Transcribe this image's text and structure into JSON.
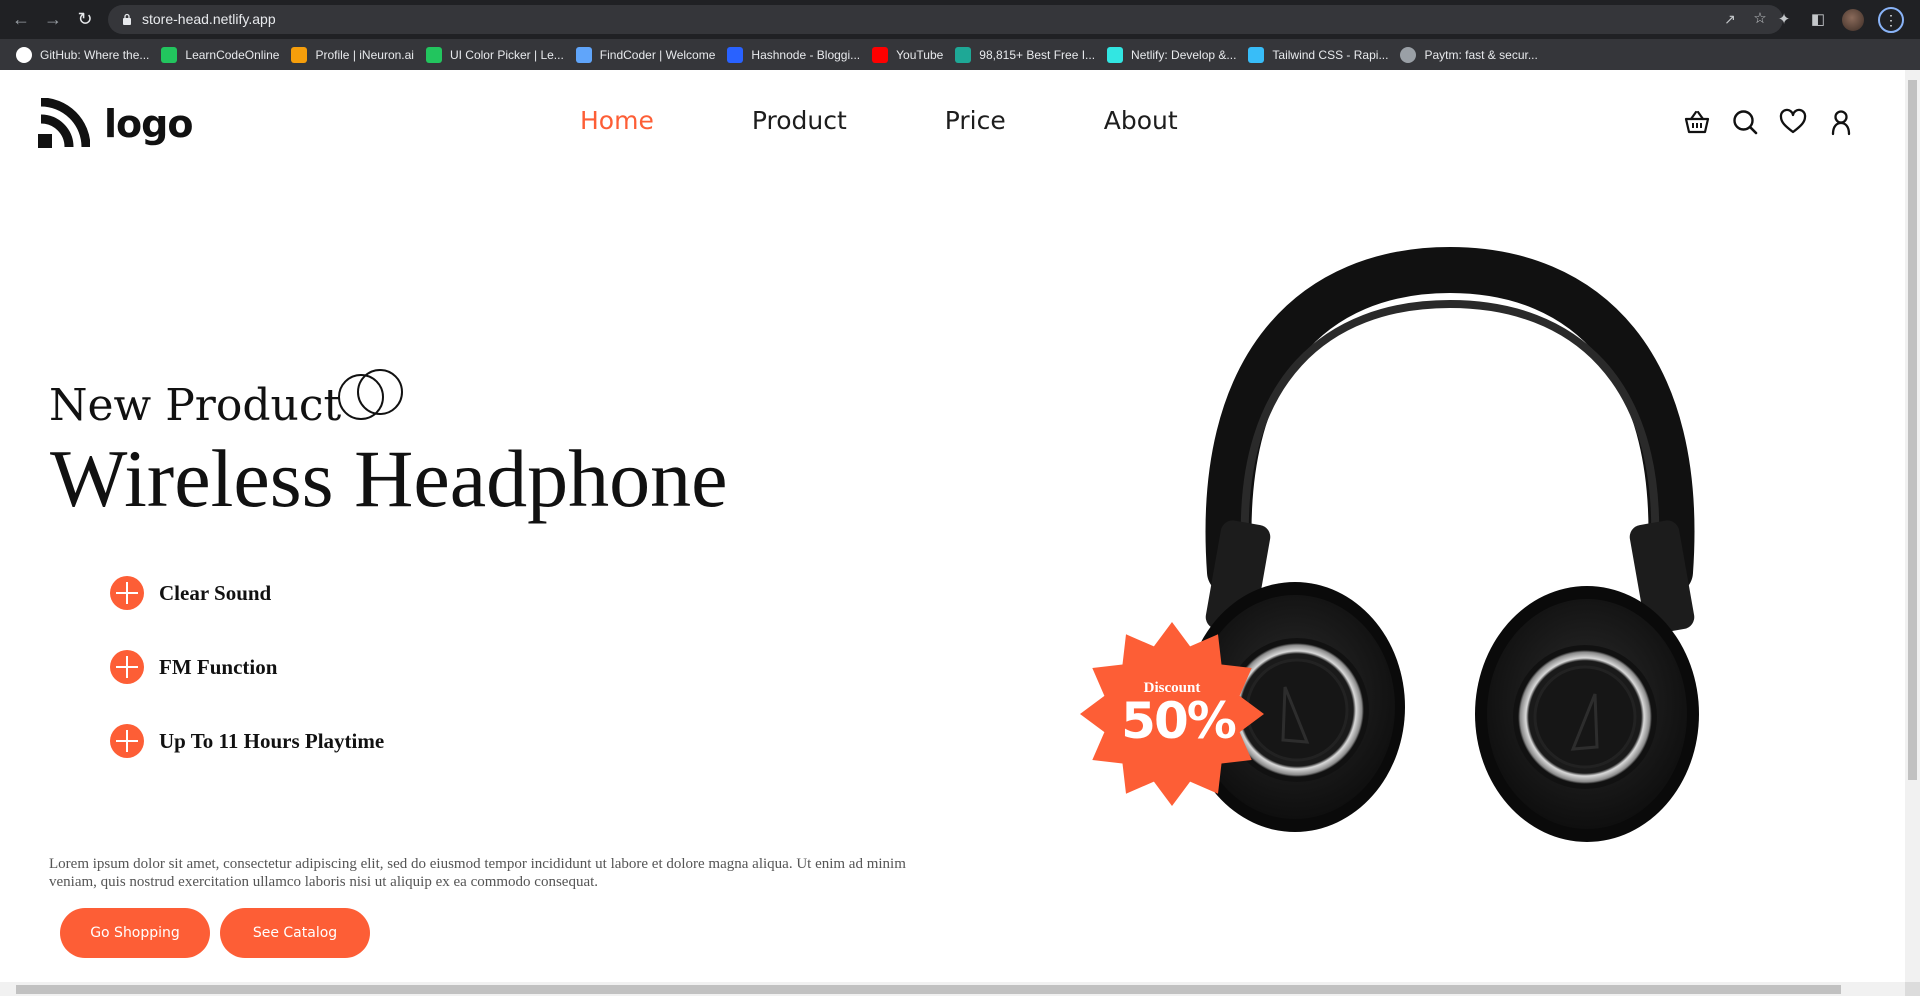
{
  "browser": {
    "url": "store-head.netlify.app",
    "bookmarks": [
      {
        "label": "GitHub: Where the...",
        "icon": "github-icon",
        "color": "#ffffff"
      },
      {
        "label": "LearnCodeOnline",
        "icon": "learncodeonline-icon",
        "color": "#22c55e"
      },
      {
        "label": "Profile | iNeuron.ai",
        "icon": "ineuron-icon",
        "color": "#f59e0b"
      },
      {
        "label": "UI Color Picker | Le...",
        "icon": "learncodeonline-icon",
        "color": "#22c55e"
      },
      {
        "label": "FindCoder | Welcome",
        "icon": "code-icon",
        "color": "#60a5fa"
      },
      {
        "label": "Hashnode - Bloggi...",
        "icon": "hashnode-icon",
        "color": "#2962ff"
      },
      {
        "label": "YouTube",
        "icon": "youtube-icon",
        "color": "#ff0000"
      },
      {
        "label": "98,815+ Best Free I...",
        "icon": "freepik-icon",
        "color": "#1ea896"
      },
      {
        "label": "Netlify: Develop &...",
        "icon": "netlify-icon",
        "color": "#32e6e2"
      },
      {
        "label": "Tailwind CSS - Rapi...",
        "icon": "tailwind-icon",
        "color": "#38bdf8"
      },
      {
        "label": "Paytm: fast & secur...",
        "icon": "globe-icon",
        "color": "#9aa0a6"
      }
    ]
  },
  "header": {
    "logo_text": "logo",
    "nav": [
      {
        "label": "Home",
        "active": true
      },
      {
        "label": "Product",
        "active": false
      },
      {
        "label": "Price",
        "active": false
      },
      {
        "label": "About",
        "active": false
      }
    ],
    "icons": [
      "basket-icon",
      "search-icon",
      "heart-icon",
      "user-icon"
    ]
  },
  "hero": {
    "kicker": "New Product",
    "title": "Wireless Headphone",
    "features": [
      "Clear Sound",
      "FM Function",
      "Up To 11 Hours Playtime"
    ],
    "description": "Lorem ipsum dolor sit amet, consectetur adipiscing elit, sed do eiusmod tempor incididunt ut labore et dolore magna aliqua. Ut enim ad minim veniam, quis nostrud exercitation ullamco laboris nisi ut aliquip ex ea commodo consequat.",
    "primary_button": "Go Shopping",
    "secondary_button": "See Catalog"
  },
  "badge": {
    "label": "Discount",
    "value": "50%"
  },
  "colors": {
    "accent": "#fd5e36",
    "text": "#111111"
  }
}
